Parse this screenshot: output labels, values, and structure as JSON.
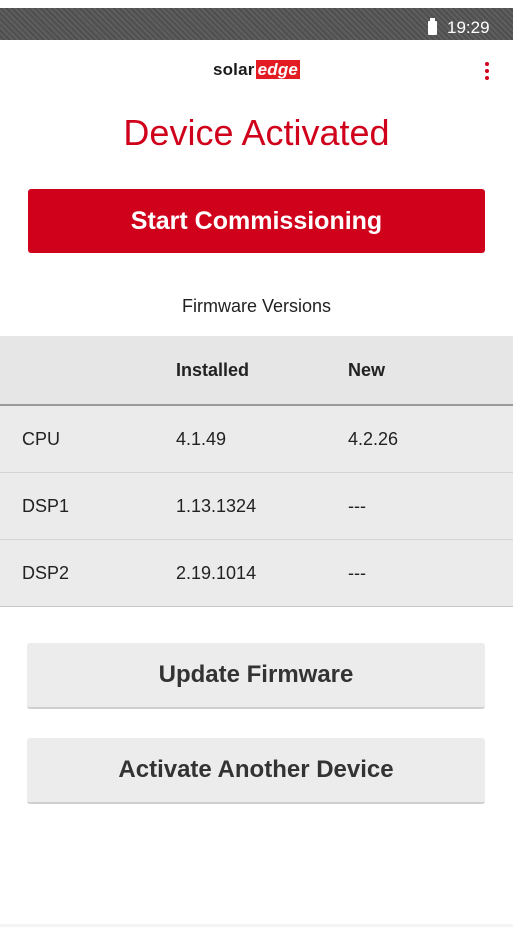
{
  "status_bar": {
    "time": "19:29",
    "battery_icon": "battery-icon"
  },
  "header": {
    "logo": {
      "part1": "solar",
      "part2": "edge"
    },
    "menu_icon": "more-vert-icon"
  },
  "page_title": "Device Activated",
  "primary_button": {
    "label": "Start Commissioning"
  },
  "firmware": {
    "title": "Firmware Versions",
    "columns": [
      "",
      "Installed",
      "New"
    ],
    "rows": [
      {
        "name": "CPU",
        "installed": "4.1.49",
        "new": "4.2.26"
      },
      {
        "name": "DSP1",
        "installed": "1.13.1324",
        "new": "---"
      },
      {
        "name": "DSP2",
        "installed": "2.19.1014",
        "new": "---"
      }
    ]
  },
  "buttons": {
    "update": "Update Firmware",
    "activate_another": "Activate Another Device"
  },
  "colors": {
    "brand_red": "#d0021b",
    "status_bar": "#545454",
    "button_gray": "#ececec"
  }
}
